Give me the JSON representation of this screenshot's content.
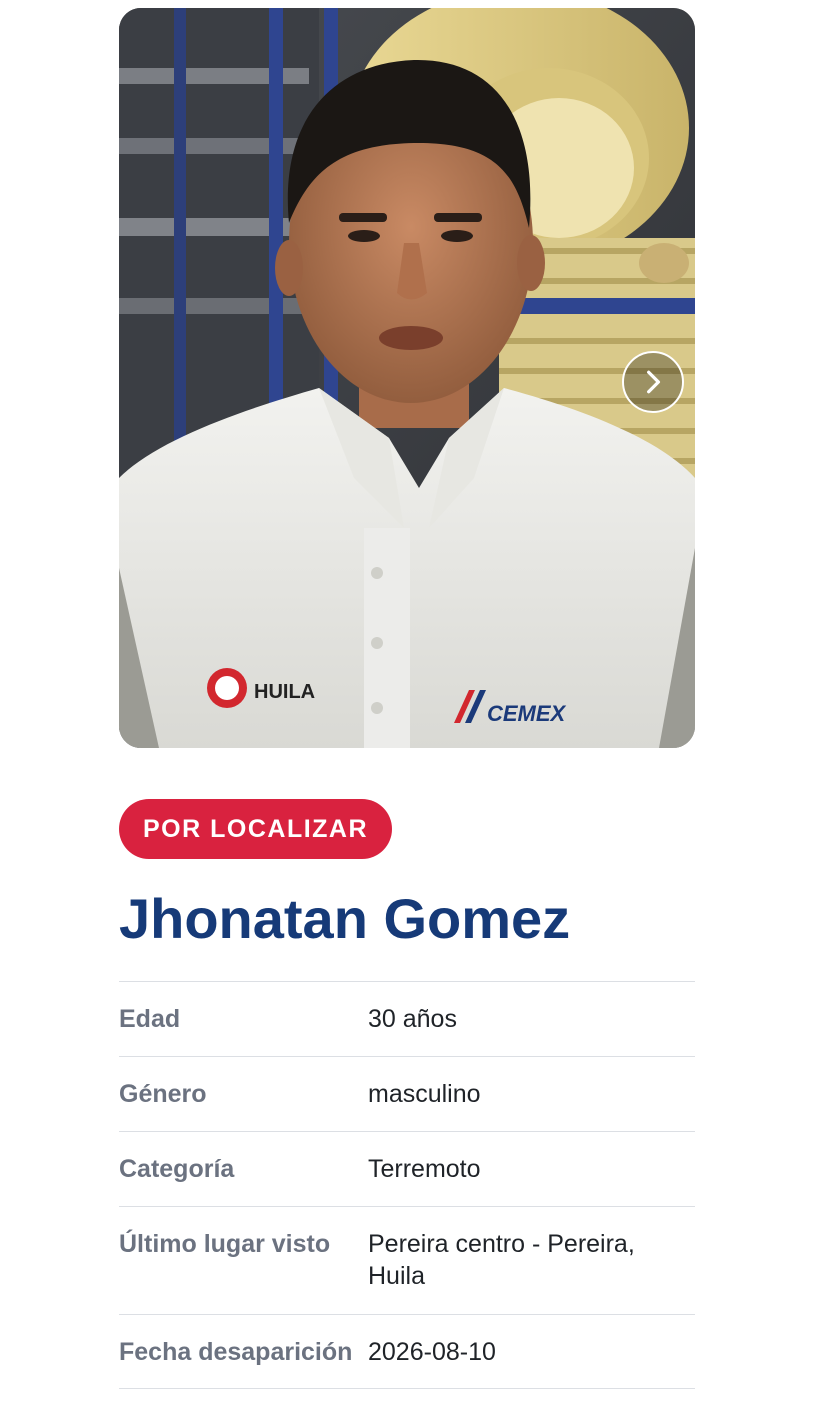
{
  "profile": {
    "photo_alt": "Foto de Jhonatan Gomez",
    "status_badge": "POR LOCALIZAR",
    "name": "Jhonatan Gomez",
    "colors": {
      "badge": "#d9223f",
      "name": "#163a78",
      "label": "#6b7280",
      "value": "#1f2328"
    },
    "details": [
      {
        "label": "Edad",
        "value": "30 años"
      },
      {
        "label": "Género",
        "value": "masculino"
      },
      {
        "label": "Categoría",
        "value": "Terremoto"
      },
      {
        "label": "Último lugar visto",
        "value": "Pereira centro - Pereira, Huila"
      },
      {
        "label": "Fecha desaparición",
        "value": "2026-08-10"
      }
    ],
    "carousel": {
      "next_icon": "chevron-right-icon"
    },
    "shirt_logos": {
      "left": "HUILA",
      "right": "CEMEX"
    }
  }
}
